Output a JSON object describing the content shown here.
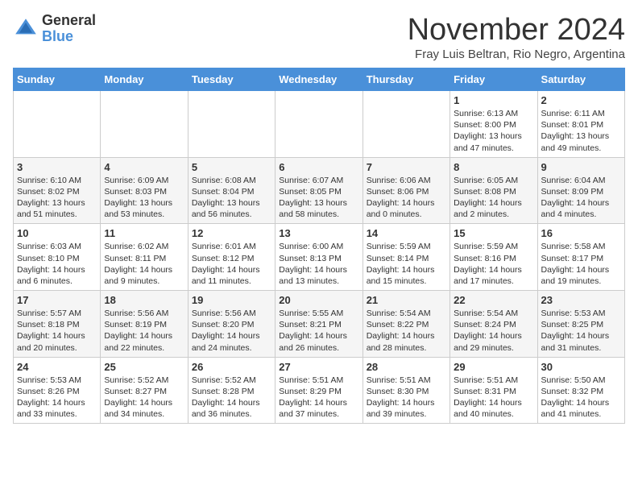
{
  "logo": {
    "general": "General",
    "blue": "Blue"
  },
  "title": "November 2024",
  "location": "Fray Luis Beltran, Rio Negro, Argentina",
  "days_of_week": [
    "Sunday",
    "Monday",
    "Tuesday",
    "Wednesday",
    "Thursday",
    "Friday",
    "Saturday"
  ],
  "weeks": [
    [
      {
        "day": "",
        "info": ""
      },
      {
        "day": "",
        "info": ""
      },
      {
        "day": "",
        "info": ""
      },
      {
        "day": "",
        "info": ""
      },
      {
        "day": "",
        "info": ""
      },
      {
        "day": "1",
        "info": "Sunrise: 6:13 AM\nSunset: 8:00 PM\nDaylight: 13 hours and 47 minutes."
      },
      {
        "day": "2",
        "info": "Sunrise: 6:11 AM\nSunset: 8:01 PM\nDaylight: 13 hours and 49 minutes."
      }
    ],
    [
      {
        "day": "3",
        "info": "Sunrise: 6:10 AM\nSunset: 8:02 PM\nDaylight: 13 hours and 51 minutes."
      },
      {
        "day": "4",
        "info": "Sunrise: 6:09 AM\nSunset: 8:03 PM\nDaylight: 13 hours and 53 minutes."
      },
      {
        "day": "5",
        "info": "Sunrise: 6:08 AM\nSunset: 8:04 PM\nDaylight: 13 hours and 56 minutes."
      },
      {
        "day": "6",
        "info": "Sunrise: 6:07 AM\nSunset: 8:05 PM\nDaylight: 13 hours and 58 minutes."
      },
      {
        "day": "7",
        "info": "Sunrise: 6:06 AM\nSunset: 8:06 PM\nDaylight: 14 hours and 0 minutes."
      },
      {
        "day": "8",
        "info": "Sunrise: 6:05 AM\nSunset: 8:08 PM\nDaylight: 14 hours and 2 minutes."
      },
      {
        "day": "9",
        "info": "Sunrise: 6:04 AM\nSunset: 8:09 PM\nDaylight: 14 hours and 4 minutes."
      }
    ],
    [
      {
        "day": "10",
        "info": "Sunrise: 6:03 AM\nSunset: 8:10 PM\nDaylight: 14 hours and 6 minutes."
      },
      {
        "day": "11",
        "info": "Sunrise: 6:02 AM\nSunset: 8:11 PM\nDaylight: 14 hours and 9 minutes."
      },
      {
        "day": "12",
        "info": "Sunrise: 6:01 AM\nSunset: 8:12 PM\nDaylight: 14 hours and 11 minutes."
      },
      {
        "day": "13",
        "info": "Sunrise: 6:00 AM\nSunset: 8:13 PM\nDaylight: 14 hours and 13 minutes."
      },
      {
        "day": "14",
        "info": "Sunrise: 5:59 AM\nSunset: 8:14 PM\nDaylight: 14 hours and 15 minutes."
      },
      {
        "day": "15",
        "info": "Sunrise: 5:59 AM\nSunset: 8:16 PM\nDaylight: 14 hours and 17 minutes."
      },
      {
        "day": "16",
        "info": "Sunrise: 5:58 AM\nSunset: 8:17 PM\nDaylight: 14 hours and 19 minutes."
      }
    ],
    [
      {
        "day": "17",
        "info": "Sunrise: 5:57 AM\nSunset: 8:18 PM\nDaylight: 14 hours and 20 minutes."
      },
      {
        "day": "18",
        "info": "Sunrise: 5:56 AM\nSunset: 8:19 PM\nDaylight: 14 hours and 22 minutes."
      },
      {
        "day": "19",
        "info": "Sunrise: 5:56 AM\nSunset: 8:20 PM\nDaylight: 14 hours and 24 minutes."
      },
      {
        "day": "20",
        "info": "Sunrise: 5:55 AM\nSunset: 8:21 PM\nDaylight: 14 hours and 26 minutes."
      },
      {
        "day": "21",
        "info": "Sunrise: 5:54 AM\nSunset: 8:22 PM\nDaylight: 14 hours and 28 minutes."
      },
      {
        "day": "22",
        "info": "Sunrise: 5:54 AM\nSunset: 8:24 PM\nDaylight: 14 hours and 29 minutes."
      },
      {
        "day": "23",
        "info": "Sunrise: 5:53 AM\nSunset: 8:25 PM\nDaylight: 14 hours and 31 minutes."
      }
    ],
    [
      {
        "day": "24",
        "info": "Sunrise: 5:53 AM\nSunset: 8:26 PM\nDaylight: 14 hours and 33 minutes."
      },
      {
        "day": "25",
        "info": "Sunrise: 5:52 AM\nSunset: 8:27 PM\nDaylight: 14 hours and 34 minutes."
      },
      {
        "day": "26",
        "info": "Sunrise: 5:52 AM\nSunset: 8:28 PM\nDaylight: 14 hours and 36 minutes."
      },
      {
        "day": "27",
        "info": "Sunrise: 5:51 AM\nSunset: 8:29 PM\nDaylight: 14 hours and 37 minutes."
      },
      {
        "day": "28",
        "info": "Sunrise: 5:51 AM\nSunset: 8:30 PM\nDaylight: 14 hours and 39 minutes."
      },
      {
        "day": "29",
        "info": "Sunrise: 5:51 AM\nSunset: 8:31 PM\nDaylight: 14 hours and 40 minutes."
      },
      {
        "day": "30",
        "info": "Sunrise: 5:50 AM\nSunset: 8:32 PM\nDaylight: 14 hours and 41 minutes."
      }
    ]
  ]
}
